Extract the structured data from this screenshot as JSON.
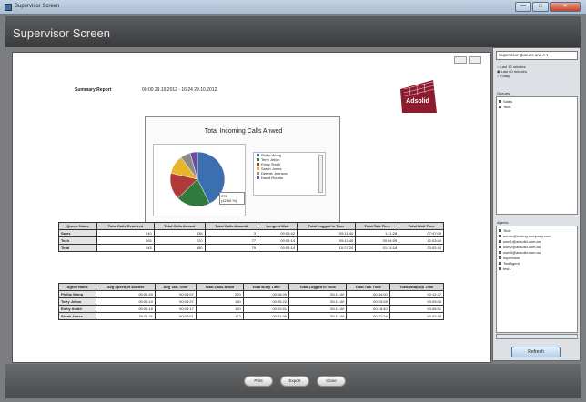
{
  "window": {
    "title": "Supervisor Screen",
    "btn_min": "—",
    "btn_max": "□",
    "btn_close": "✕"
  },
  "header": {
    "title": "Supervisor Screen"
  },
  "report": {
    "summary_label": "Summary Report",
    "summary_date": "00:00 29.10.2012 - 16:24 29.10.2012",
    "logo_text": "Adsolid",
    "chart_title": "Total Incoming Calls Anwed",
    "tooltip_line1": "276",
    "tooltip_line2": "(42.65 %)",
    "queue_table": {
      "headers": [
        "Queue Name",
        "Total Calls Received",
        "Total Calls Answd",
        "Total Calls Abandd",
        "Longest Wait",
        "Total Logged in Time",
        "Total Talk Time",
        "Total Wait Time"
      ],
      "rows": [
        [
          "Sales",
          "240",
          "338",
          "3",
          "00:03:42",
          "05:11:40",
          "1:11:28",
          "07:47:00"
        ],
        [
          "Tech",
          "265",
          "220",
          "77",
          "00:05:14",
          "05:11:40",
          "00:04:09",
          "12:03:44"
        ],
        [
          "Total",
          "645",
          "580",
          "79",
          "00:05:14",
          "10:27:20",
          "01:14:18",
          "20:02:44"
        ]
      ]
    },
    "agent_table": {
      "headers": [
        "Agent Name",
        "Avg Speed of Answer",
        "Avg Talk Time",
        "Total Calls Anwd",
        "Total Busy Time",
        "Total Logged in Time",
        "Total Talk Time",
        "Total Wrap-up Time"
      ],
      "rows": [
        [
          "Phillip Wong",
          "00:01:20",
          "00:03:07",
          "220",
          "00:18:00",
          "05:11:40",
          "00:44:00",
          "00:12:27"
        ],
        [
          "Terry Jellon",
          "00:01:10",
          "00:03:27",
          "180",
          "00:05:22",
          "05:11:40",
          "00:03:28",
          "00:09:00"
        ],
        [
          "Emily Smith",
          "00:01:15",
          "00:03:17",
          "120",
          "00:02:51",
          "05:11:40",
          "00:18:40",
          "00:06:51"
        ],
        [
          "Sarah Jones",
          "00:01:11",
          "00:03:01",
          "112",
          "00:01:00",
          "05:11:40",
          "00:47:24",
          "00:03:48"
        ]
      ]
    }
  },
  "chart_data": {
    "type": "pie",
    "title": "Total Incoming Calls Anwed",
    "labels": [
      "Phillip Wong",
      "Terry Jellon",
      "Emily Smith",
      "Sarah Jones",
      "Debbie Johnson",
      "David Rourke"
    ],
    "values": [
      42.65,
      20,
      16,
      11,
      6,
      4.35
    ],
    "colors": [
      "#3c6fb0",
      "#2f7a3c",
      "#b03a3a",
      "#e7b52c",
      "#8a8a8a",
      "#6a4ea0"
    ]
  },
  "sidebar": {
    "select_value": "Supervisor Queues and A ▾",
    "radios": [
      "Last 15 minutes",
      "Last 60 minutes",
      "Today"
    ],
    "queues_label": "Queues",
    "queues": [
      "Sales",
      "Tech"
    ],
    "agents_label": "Agents",
    "agents": [
      "Tech",
      "admin@testing.company.com",
      "user1@adsolid.com.au",
      "user2@adsolid.com.au",
      "user3@adsolid.com.au",
      "supervisor",
      "TestAgent",
      "test1"
    ],
    "refresh_label": "Refresh"
  },
  "footer": {
    "print": "Print",
    "export": "Export",
    "close": "Close"
  }
}
